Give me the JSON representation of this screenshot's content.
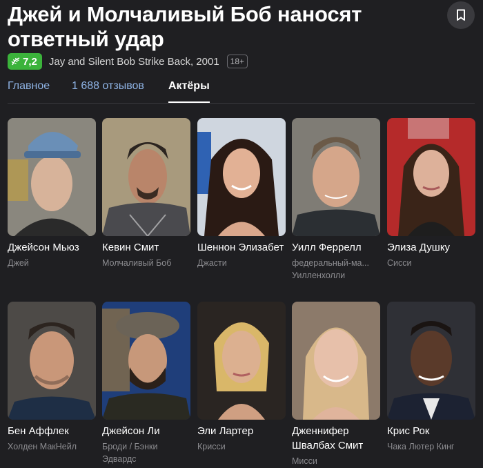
{
  "movie": {
    "title": "Джей и Молчаливый Боб наносят ответный удар",
    "rating": "7,2",
    "original": "Jay and Silent Bob Strike Back, 2001",
    "age": "18+"
  },
  "tabs": [
    {
      "label": "Главное"
    },
    {
      "label": "1 688 отзывов"
    },
    {
      "label": "Актёры"
    }
  ],
  "actors": [
    {
      "name": "Джейсон Мьюз",
      "role": "Джей"
    },
    {
      "name": "Кевин Смит",
      "role": "Молчаливый Боб"
    },
    {
      "name": "Шеннон Элизабет",
      "role": "Джасти"
    },
    {
      "name": "Уилл Феррелл",
      "role": "федеральный-ма... Уилленхолли"
    },
    {
      "name": "Элиза Душку",
      "role": "Сисси"
    },
    {
      "name": "Бен Аффлек",
      "role": "Холден МакНейл"
    },
    {
      "name": "Джейсон Ли",
      "role": "Броди / Бэнки Эдвардс"
    },
    {
      "name": "Эли Лартер",
      "role": "Крисси"
    },
    {
      "name": "Дженнифер Швалбах Смит",
      "role": "Мисси"
    },
    {
      "name": "Крис Рок",
      "role": "Чака Лютер Кинг"
    }
  ],
  "colors": {
    "background": "#1f1f22",
    "rating_green": "#3bb33b",
    "tab_link": "#8fb4e6"
  },
  "icons": {
    "bookmark": "bookmark-icon",
    "rating": "laurel-icon"
  }
}
